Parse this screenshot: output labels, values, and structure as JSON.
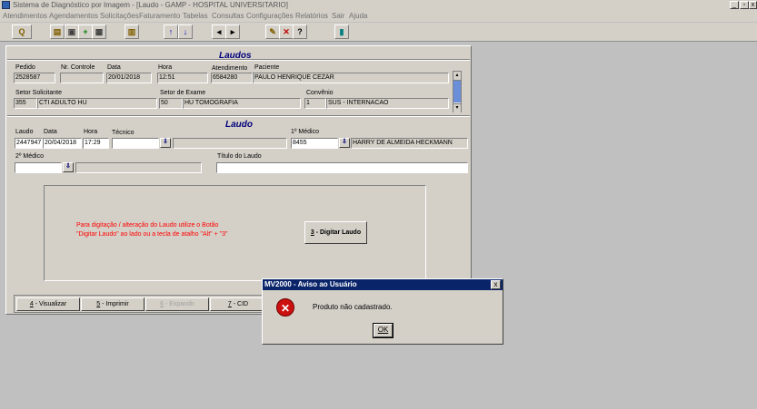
{
  "window": {
    "title": "Sistema de Diagnóstico por Imagem - [Laudo - GAMP - HOSPITAL UNIVERSITARIO]"
  },
  "menu": [
    "Atendimentos",
    "Agendamentos",
    "Solicitações",
    "Faturamento",
    "Tabelas",
    "Consultas",
    "Configurações",
    "Relatórios",
    "Sair",
    "Ajuda"
  ],
  "laudos": {
    "title": "Laudos",
    "pedido_label": "Pedido",
    "pedido": "2528587",
    "nr_controle_label": "Nr. Controle",
    "nr_controle": "",
    "data_label": "Data",
    "data": "20/01/2018",
    "hora_label": "Hora",
    "hora": "12:51",
    "atendimento_label": "Atendimento",
    "atendimento": "6584280",
    "paciente_label": "Paciente",
    "paciente": "PAULO HENRIQUE CEZAR",
    "setor_solicitante_label": "Setor Solicitante",
    "setor_solicitante_code": "355",
    "setor_solicitante_name": "CTI ADULTO HU",
    "setor_exame_label": "Setor de Exame",
    "setor_exame_code": "50",
    "setor_exame_name": "HU TOMOGRAFIA",
    "convenio_label": "Convênio",
    "convenio_code": "1",
    "convenio_name": "SUS - INTERNACAO"
  },
  "laudo": {
    "title": "Laudo",
    "laudo_label": "Laudo",
    "laudo": "2447947",
    "data_label": "Data",
    "data": "20/04/2018",
    "hora_label": "Hora",
    "hora": "17:29",
    "tecnico_label": "Técnico",
    "tecnico_code": "",
    "tecnico_name": "",
    "medico1_label": "1º Médico",
    "medico1_code": "8455",
    "medico1_name": "HARRY DE ALMEIDA HECKMANN",
    "medico2_label": "2º Médico",
    "medico2_code": "",
    "medico2_name": "",
    "titulo_label": "Título do Laudo",
    "titulo": "",
    "info_line1": "Para digitação / alteração do Laudo utilize o Botão",
    "info_line2": "\"Digitar Laudo\" ao lado ou a tecla de atalho \"Alt\" + \"3\"",
    "digitar_key": "3",
    "digitar_text": " - Digitar Laudo"
  },
  "bottom_buttons": [
    {
      "key": "4",
      "text": " - Visualizar"
    },
    {
      "key": "5",
      "text": " - Imprimir"
    },
    {
      "key": "6",
      "text": " - Expandir"
    },
    {
      "key": "7",
      "text": " - CID"
    }
  ],
  "dialog": {
    "title": "MV2000 - Aviso ao Usuário",
    "message": "Produto não cadastrado.",
    "ok": "OK",
    "close": "x"
  },
  "colors": {
    "title_bar_active": "#0a246a",
    "section_title": "#00007a",
    "info_text": "#ff0000",
    "error_icon": "#cc1010"
  }
}
